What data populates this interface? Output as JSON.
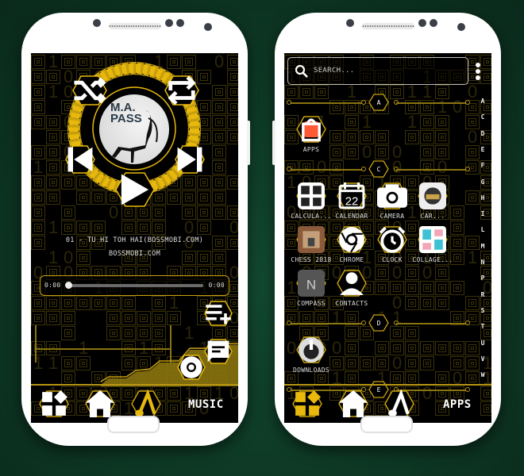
{
  "music_screen": {
    "album": {
      "title_line1": "M.A.",
      "title_line2": "PASS"
    },
    "controls": {
      "shuffle_icon": "shuffle-icon",
      "repeat_icon": "repeat-icon",
      "prev_icon": "skip-previous-icon",
      "next_icon": "skip-next-icon",
      "play_icon": "play-icon"
    },
    "track": {
      "title": "01 - TU HI TOH HAI(BOSSMOBI.COM)",
      "artist": "BOSSMOBI.COM"
    },
    "progress": {
      "elapsed": "0:00",
      "total": "0:00",
      "fraction": 0.0
    },
    "side_buttons": [
      "playlist-add-icon",
      "message-icon",
      "chrome-icon"
    ],
    "dock": {
      "label": "MUSIC",
      "buttons": [
        "widgets-icon",
        "home-icon",
        "music-note-icon"
      ]
    }
  },
  "apps_screen": {
    "search": {
      "placeholder": "SEARCH..."
    },
    "menu_icon": "more-vert-icon",
    "sections": [
      {
        "letter": "A",
        "apps": [
          {
            "label": "APPS",
            "icon": "apps-store-icon",
            "color": "#ff5a36"
          }
        ]
      },
      {
        "letter": "C",
        "apps": [
          {
            "label": "CALCULA...",
            "icon": "calculator-icon"
          },
          {
            "label": "CALENDAR",
            "icon": "calendar-icon",
            "badge": "22"
          },
          {
            "label": "CAMERA",
            "icon": "camera-icon"
          },
          {
            "label": "CAR...",
            "icon": "car-icon"
          },
          {
            "label": "CHESS 2018",
            "icon": "chess-icon"
          },
          {
            "label": "CHROME",
            "icon": "chrome-icon"
          },
          {
            "label": "CLOCK",
            "icon": "alarm-clock-icon"
          },
          {
            "label": "COLLAGE...",
            "icon": "collage-icon"
          },
          {
            "label": "COMPASS",
            "icon": "compass-icon"
          },
          {
            "label": "CONTACTS",
            "icon": "contacts-icon"
          }
        ]
      },
      {
        "letter": "D",
        "apps": [
          {
            "label": "DOWNLOADS",
            "icon": "downloads-icon"
          }
        ]
      },
      {
        "letter": "E",
        "apps": []
      }
    ],
    "alphabet_index": [
      "A",
      "C",
      "D",
      "E",
      "F",
      "G",
      "H",
      "I",
      "L",
      "M",
      "N",
      "P",
      "R",
      "S",
      "T",
      "U",
      "V",
      "W"
    ],
    "dock": {
      "label": "APPS",
      "buttons": [
        "widgets-icon",
        "home-icon",
        "music-note-icon"
      ]
    }
  },
  "colors": {
    "accent": "#e8b90c",
    "accent_dark": "#8a7410",
    "background": "#000000",
    "pattern": "#3a3208",
    "wallpaper": "#0e3a26"
  }
}
